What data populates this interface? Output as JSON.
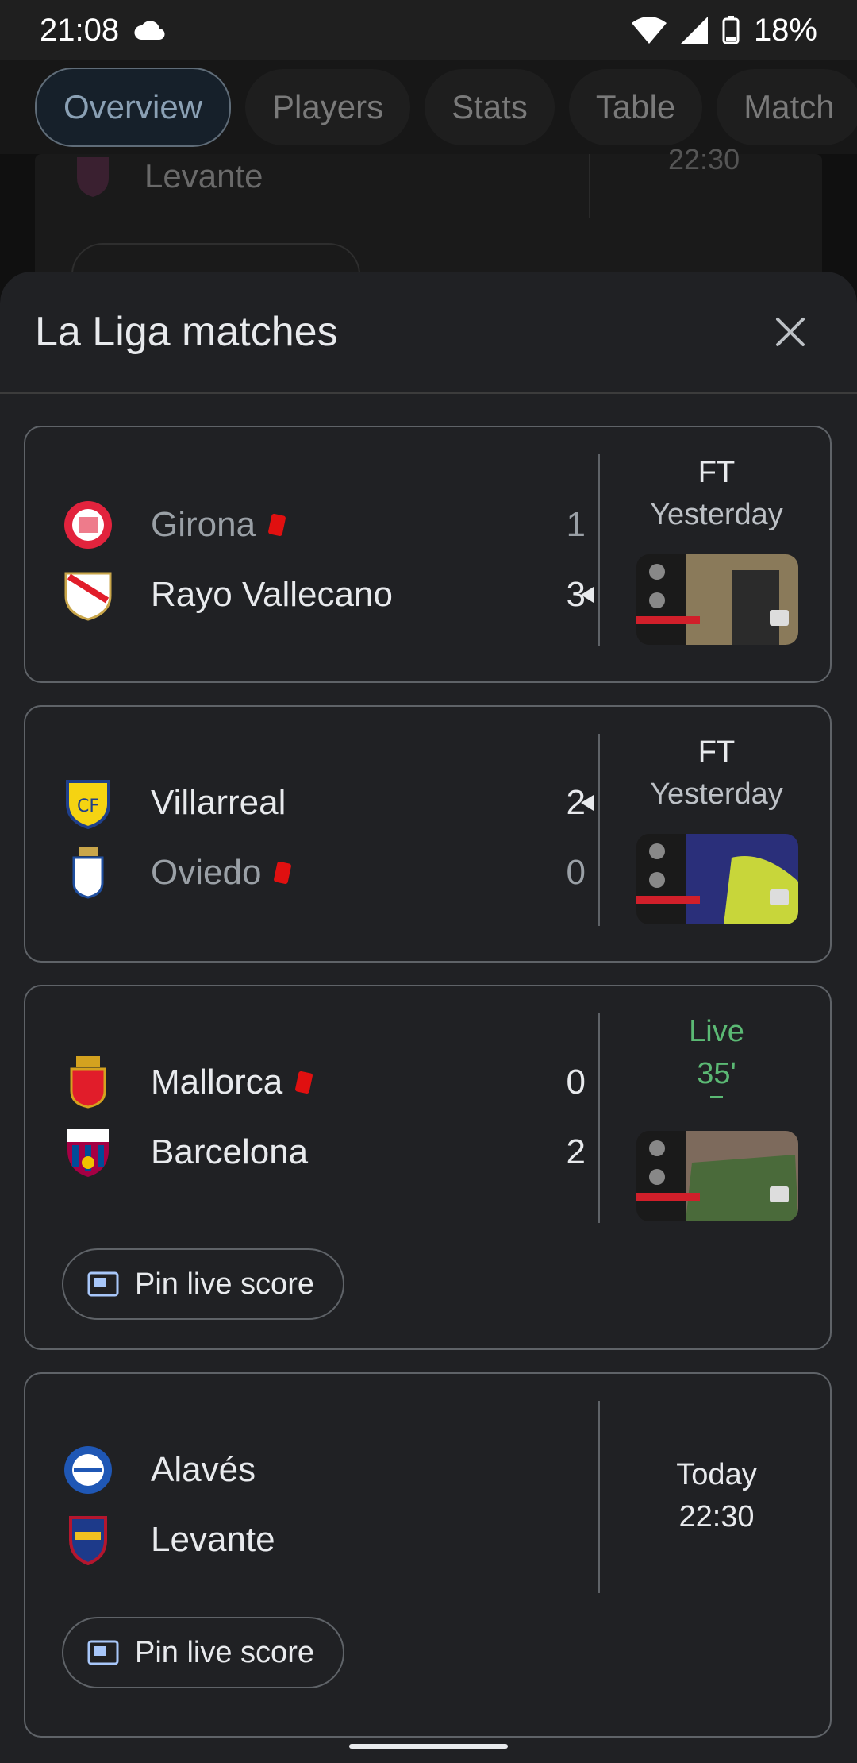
{
  "status_bar": {
    "time": "21:08",
    "battery": "18%"
  },
  "tabs": [
    {
      "label": "Overview",
      "active": true
    },
    {
      "label": "Players"
    },
    {
      "label": "Stats"
    },
    {
      "label": "Table"
    },
    {
      "label": "Match"
    }
  ],
  "background": {
    "team": "Levante",
    "time": "22:30"
  },
  "sheet": {
    "title": "La Liga matches"
  },
  "matches": [
    {
      "home": {
        "name": "Girona",
        "score": "1",
        "red_card": true,
        "winner": false
      },
      "away": {
        "name": "Rayo Vallecano",
        "score": "3",
        "red_card": false,
        "winner": true
      },
      "status": "FT",
      "when": "Yesterday"
    },
    {
      "home": {
        "name": "Villarreal",
        "score": "2",
        "red_card": false,
        "winner": true
      },
      "away": {
        "name": "Oviedo",
        "score": "0",
        "red_card": true,
        "winner": false
      },
      "status": "FT",
      "when": "Yesterday"
    },
    {
      "home": {
        "name": "Mallorca",
        "score": "0",
        "red_card": true,
        "winner": false
      },
      "away": {
        "name": "Barcelona",
        "score": "2",
        "red_card": false,
        "winner": false
      },
      "status": "Live",
      "when": "35'",
      "pin_label": "Pin live score"
    },
    {
      "home": {
        "name": "Alavés"
      },
      "away": {
        "name": "Levante"
      },
      "status": "Today",
      "when": "22:30",
      "pin_label": "Pin live score"
    }
  ],
  "colors": {
    "live": "#5bb974",
    "red_card": "#e01010",
    "sheet_bg": "#202124"
  }
}
